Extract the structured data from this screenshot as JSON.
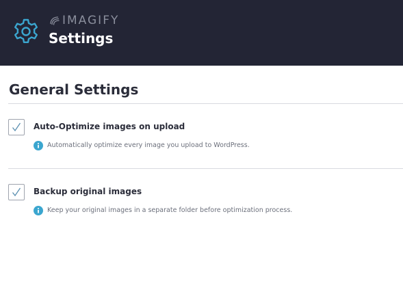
{
  "header": {
    "brand": "IMAGIFY",
    "title": "Settings",
    "icon": "gear-icon",
    "bg_color": "#232535",
    "accent_color": "#3ba6cf"
  },
  "general": {
    "title": "General Settings",
    "options": [
      {
        "label": "Auto-Optimize images on upload",
        "description": "Automatically optimize every image you upload to WordPress.",
        "checked": true
      },
      {
        "label": "Backup original images",
        "description": "Keep your original images in a separate folder before optimization process.",
        "checked": true
      }
    ]
  }
}
